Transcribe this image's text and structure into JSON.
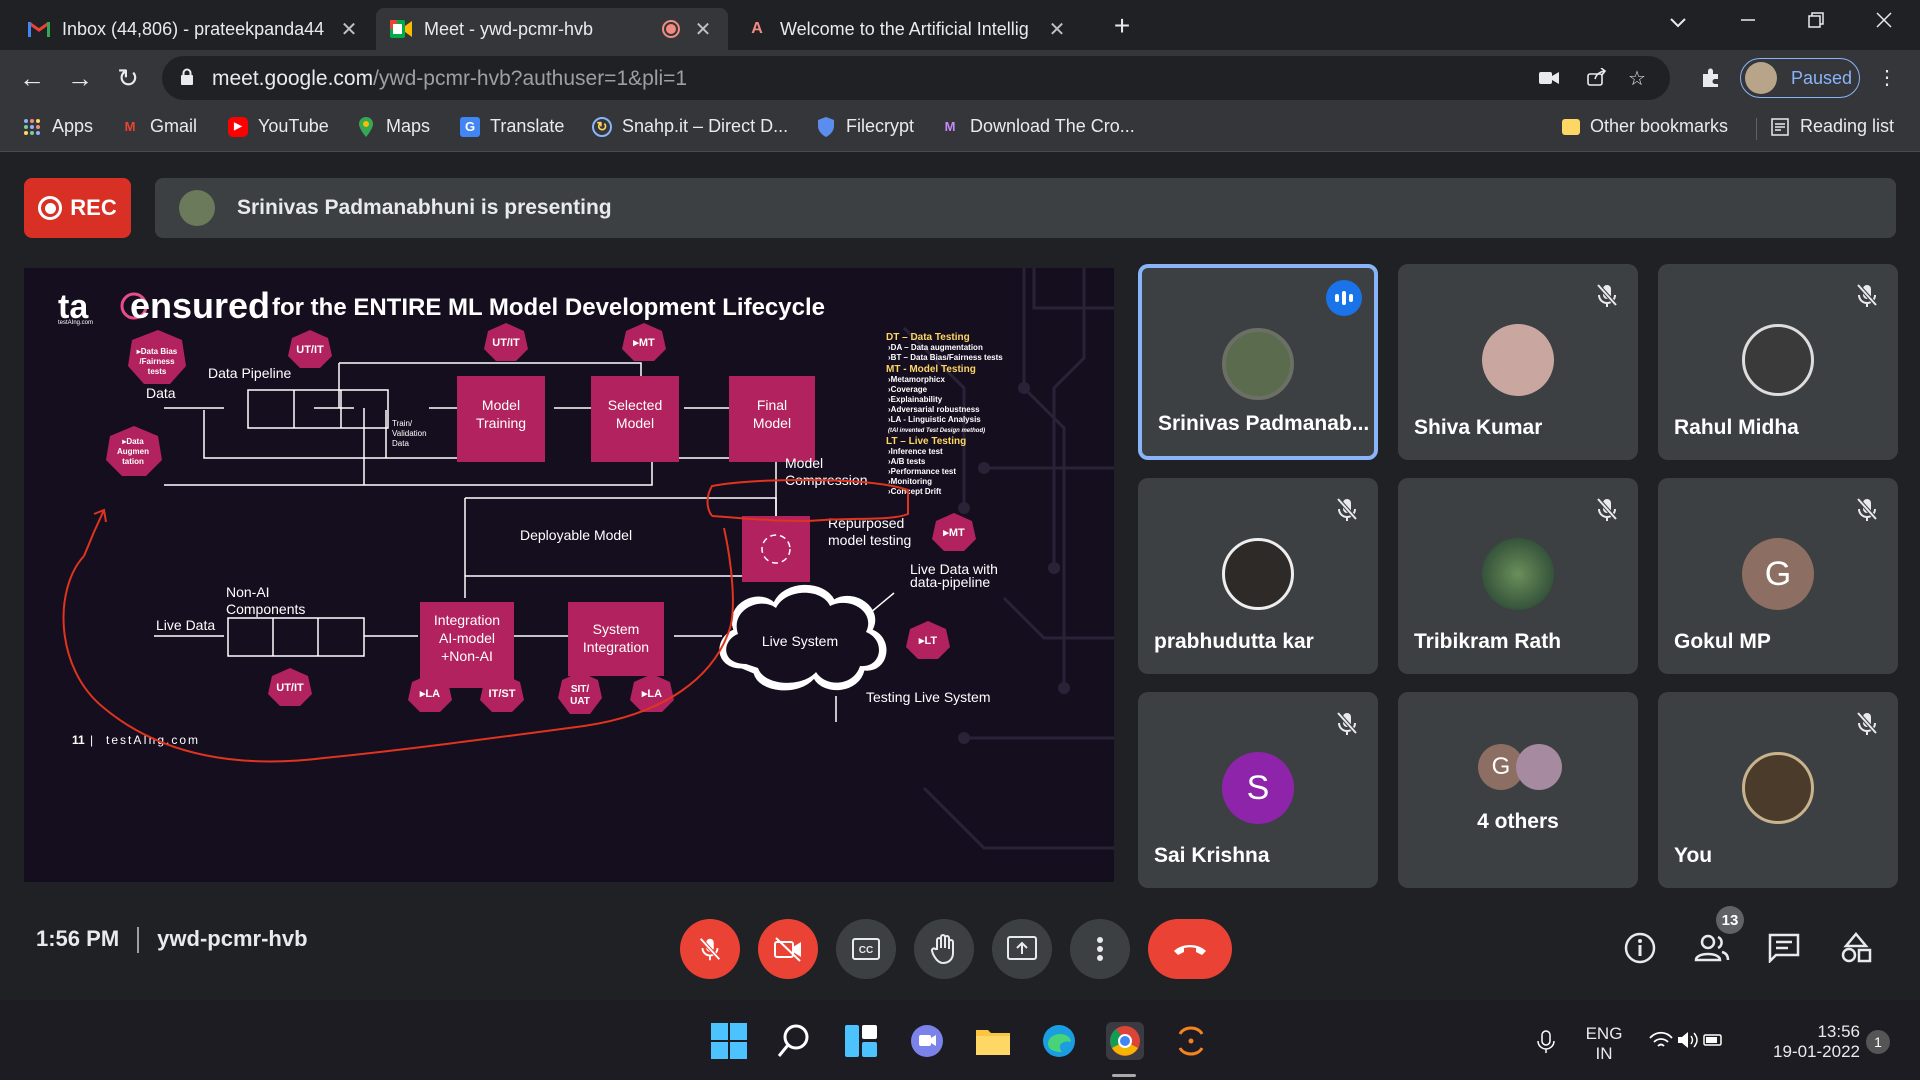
{
  "browser": {
    "tabs": [
      {
        "title": "Inbox (44,806) - prateekpanda44",
        "icon": "gmail-icon",
        "close": "✕"
      },
      {
        "title": "Meet - ywd-pcmr-hvb",
        "icon": "meet-icon",
        "close": "✕"
      },
      {
        "title": "Welcome to the Artificial Intellig",
        "icon": "ai-icon",
        "close": "✕"
      }
    ],
    "url_domain": "meet.google.com",
    "url_path": "/ywd-pcmr-hvb?authuser=1&pli=1",
    "profile_label": "Paused",
    "bookmarks": [
      {
        "label": "Apps",
        "icon": "apps-grid-icon"
      },
      {
        "label": "Gmail",
        "icon": "gmail-icon"
      },
      {
        "label": "YouTube",
        "icon": "youtube-icon"
      },
      {
        "label": "Maps",
        "icon": "maps-icon"
      },
      {
        "label": "Translate",
        "icon": "translate-icon"
      },
      {
        "label": "Snahp.it – Direct D...",
        "icon": "snahp-icon"
      },
      {
        "label": "Filecrypt",
        "icon": "shield-icon"
      },
      {
        "label": "Download The Cro...",
        "icon": "bookmark-site-icon"
      }
    ],
    "other_bookmarks": "Other bookmarks",
    "reading_list": "Reading list"
  },
  "meet": {
    "rec_label": "REC",
    "presenting_text": "Srinivas Padmanabhuni is presenting",
    "time": "1:56 PM",
    "meeting_code": "ywd-pcmr-hvb",
    "participant_count": "13",
    "participants": [
      {
        "name": "Srinivas Padmanab...",
        "avatar": "photo",
        "color": "#5a6b4e",
        "speaking": true
      },
      {
        "name": "Shiva Kumar",
        "avatar": "photo",
        "color": "#c9a7a0",
        "muted": true
      },
      {
        "name": "Rahul Midha",
        "avatar": "photo",
        "color": "#3a3a3a",
        "muted": true
      },
      {
        "name": "prabhudutta kar",
        "avatar": "photo",
        "color": "#2d2a28",
        "muted": true
      },
      {
        "name": "Tribikram Rath",
        "avatar": "photo",
        "color": "#1f3a2e",
        "muted": true
      },
      {
        "name": "Gokul MP",
        "avatar": "G",
        "color": "#8d6e63",
        "muted": true
      },
      {
        "name": "Sai Krishna",
        "avatar": "S",
        "color": "#8e24aa",
        "muted": true
      },
      {
        "name": "4 others",
        "avatar": "G",
        "color": "#8d6e63"
      },
      {
        "name": "You",
        "avatar": "photo",
        "color": "#4a3b2a",
        "muted": true
      }
    ]
  },
  "slide": {
    "brand": "ta",
    "brand_sub": "testAIng.com",
    "title_big": "ensured",
    "title_rest": "for the ENTIRE ML Model Development Lifecycle",
    "page": "11",
    "footer": "testAIng.com",
    "hex": {
      "data_bias": [
        "▸Data Bias",
        "/Fairness",
        "tests"
      ],
      "data_aug": [
        "▸Data",
        "Augmen",
        "tation"
      ],
      "utit1": "UT/IT",
      "utit2": "UT/IT",
      "utit3": "UT/IT",
      "mt1": "▸MT",
      "mt2": "▸MT",
      "la1": "▸LA",
      "itst": "IT/ST",
      "sit": [
        "SIT/",
        "UAT"
      ],
      "la2": "▸LA",
      "lt": "▸LT"
    },
    "labels": {
      "data_pipeline": "Data Pipeline",
      "data": "Data",
      "train_val": [
        "Train/",
        "Validation",
        "Data"
      ],
      "model_training": [
        "Model",
        "Training"
      ],
      "selected_model": [
        "Selected",
        "Model"
      ],
      "final_model": [
        "Final",
        "Model"
      ],
      "model_compression": [
        "Model",
        "Compression"
      ],
      "deployable": "Deployable Model",
      "repurposed": [
        "Repurposed",
        "model testing"
      ],
      "live_data_pipe": [
        "Live Data with",
        "data-pipeline"
      ],
      "non_ai": [
        "Non-AI",
        "Components"
      ],
      "live_data": "Live Data",
      "integration": [
        "Integration",
        "AI-model",
        "+Non-AI"
      ],
      "system_integration": [
        "System",
        "Integration"
      ],
      "live_system": "Live System",
      "testing_live": "Testing Live System"
    },
    "legend": [
      {
        "t": "DT – Data Testing",
        "h": true
      },
      {
        "t": "›DA – Data augmentation"
      },
      {
        "t": "›BT – Data Bias/Fairness tests"
      },
      {
        "t": "MT - Model Testing",
        "h": true
      },
      {
        "t": "›Metamorphicx"
      },
      {
        "t": "›Coverage"
      },
      {
        "t": "›Explainability"
      },
      {
        "t": "›Adversarial robustness"
      },
      {
        "t": "›LA - Linguistic Analysis"
      },
      {
        "t": "(tAI invented Test Design method)",
        "i": true
      },
      {
        "t": "LT – Live Testing",
        "h": true
      },
      {
        "t": "›Inference test"
      },
      {
        "t": "›A/B tests"
      },
      {
        "t": "›Performance test"
      },
      {
        "t": "›Monitoring"
      },
      {
        "t": "›Concept Drift"
      }
    ]
  },
  "taskbar": {
    "lang1": "ENG",
    "lang2": "IN",
    "time": "13:56",
    "date": "19-01-2022",
    "notif": "1"
  }
}
